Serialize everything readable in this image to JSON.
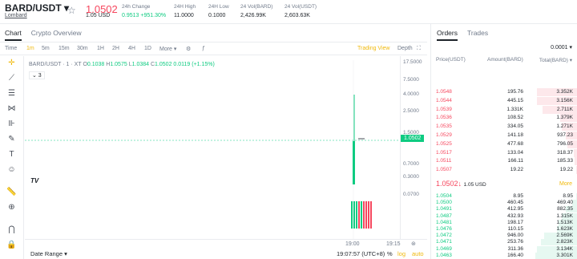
{
  "header": {
    "pair": "BARD/USDT",
    "pair_caret": "▾",
    "lombard": "Lombard",
    "price": "1.0502",
    "price_usd": "1.05 USD",
    "stats": [
      {
        "label": "24h Change",
        "value": "0.9513 +951.30%",
        "color": "green"
      },
      {
        "label": "24H High",
        "value": "11.0000"
      },
      {
        "label": "24H Low",
        "value": "0.1000"
      },
      {
        "label": "24 Vol(BARD)",
        "value": "2,426.99K"
      },
      {
        "label": "24 Vol(USDT)",
        "value": "2,603.63K"
      }
    ]
  },
  "tabs": {
    "chart": "Chart",
    "overview": "Crypto Overview"
  },
  "toolbar": {
    "time": "Time",
    "intervals": [
      "1m",
      "5m",
      "15m",
      "30m",
      "1H",
      "2H",
      "4H",
      "1D",
      "More ▾"
    ],
    "trading_view": "Trading View",
    "depth": "Depth"
  },
  "ohlc": {
    "title": "BARD/USDT · 1 · XT",
    "o_label": "O",
    "o": "0.1038",
    "h_label": "H",
    "h": "1.0575",
    "l_label": "L",
    "l": "1.0384",
    "c_label": "C",
    "c": "1.0502",
    "chg": "0.0119 (+1.15%)"
  },
  "vol_toggle": "⌄ 3",
  "yaxis": [
    {
      "v": "17.5000",
      "t": 4
    },
    {
      "v": "7.5000",
      "t": 26
    },
    {
      "v": "4.0000",
      "t": 44
    },
    {
      "v": "2.5000",
      "t": 65
    },
    {
      "v": "1.5000",
      "t": 92
    },
    {
      "v": "0.7000",
      "t": 131
    },
    {
      "v": "0.3000",
      "t": 147
    },
    {
      "v": "0.0700",
      "t": 169
    }
  ],
  "last_price": "1.0502",
  "xaxis": {
    "t1": "19:00",
    "t2": "19:15"
  },
  "bottom": {
    "date_range": "Date Range ▾",
    "clock": "19:07:57 (UTC+8)",
    "pct": "%",
    "log": "log",
    "auto": "auto"
  },
  "orders": {
    "tab1": "Orders",
    "tab2": "Trades",
    "precision": "0.0001 ▾",
    "col_price": "Price(USDT)",
    "col_amount": "Amount(BARD)",
    "col_total": "Total(BARD) ▾",
    "asks": [
      [
        "1.0548",
        "195.76",
        "3.352K",
        0.28
      ],
      [
        "1.0544",
        "445.15",
        "3.156K",
        0.28
      ],
      [
        "1.0539",
        "1.331K",
        "2.711K",
        0.24
      ],
      [
        "1.0536",
        "108.52",
        "1.379K",
        0.12
      ],
      [
        "1.0535",
        "334.05",
        "1.271K",
        0.11
      ],
      [
        "1.0529",
        "141.18",
        "937.23",
        0.08
      ],
      [
        "1.0525",
        "477.68",
        "796.05",
        0.07
      ],
      [
        "1.0517",
        "133.04",
        "318.37",
        0.03
      ],
      [
        "1.0511",
        "166.11",
        "185.33",
        0.02
      ],
      [
        "1.0507",
        "19.22",
        "19.22",
        0.01
      ]
    ],
    "mid_price": "1.0502↓",
    "mid_usd": "1.05 USD",
    "more": "More",
    "bids": [
      [
        "1.0504",
        "8.95",
        "8.95",
        0.01
      ],
      [
        "1.0500",
        "460.45",
        "469.40",
        0.04
      ],
      [
        "1.0491",
        "412.95",
        "882.35",
        0.08
      ],
      [
        "1.0487",
        "432.93",
        "1.315K",
        0.11
      ],
      [
        "1.0481",
        "198.17",
        "1.513K",
        0.13
      ],
      [
        "1.0476",
        "110.15",
        "1.623K",
        0.14
      ],
      [
        "1.0472",
        "946.00",
        "2.569K",
        0.23
      ],
      [
        "1.0471",
        "253.76",
        "2.823K",
        0.25
      ],
      [
        "1.0469",
        "311.36",
        "3.134K",
        0.28
      ],
      [
        "1.0463",
        "166.40",
        "3.301K",
        0.29
      ]
    ]
  },
  "colors": {
    "up": "#0ecb81",
    "down": "#f6465d",
    "accent": "#f0b90b"
  }
}
